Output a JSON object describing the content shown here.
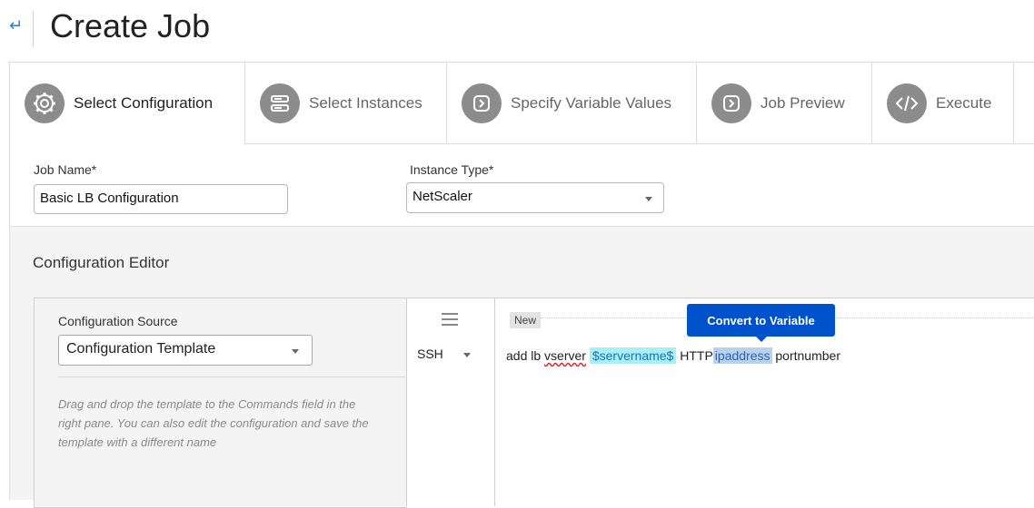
{
  "header": {
    "title": "Create Job"
  },
  "tabs": [
    {
      "label": "Select Configuration",
      "active": true,
      "icon": "gear-icon"
    },
    {
      "label": "Select Instances",
      "active": false,
      "icon": "server-icon"
    },
    {
      "label": "Specify Variable Values",
      "active": false,
      "icon": "chevron-right-icon"
    },
    {
      "label": "Job Preview",
      "active": false,
      "icon": "chevron-right-icon"
    },
    {
      "label": "Execute",
      "active": false,
      "icon": "code-icon"
    }
  ],
  "form": {
    "job_name_label": "Job Name*",
    "job_name_value": "Basic LB Configuration",
    "instance_type_label": "Instance Type*",
    "instance_type_value": "NetScaler"
  },
  "editor": {
    "title": "Configuration Editor",
    "source_label": "Configuration Source",
    "source_value": "Configuration Template",
    "help_text": "Drag and drop the template to the Commands field in the right pane. You can also edit the configuration and save the template with a different name",
    "protocol": "SSH",
    "new_badge": "New",
    "tooltip": "Convert to Variable",
    "command": {
      "part1": "add lb ",
      "part2": "vserver",
      "variable": "$servername$",
      "part3": "HTTP",
      "selected": "ipaddress",
      "part4": "portnumber"
    }
  },
  "colors": {
    "accent": "#0052cc",
    "variable_bg": "#a9f0f5",
    "selection_bg": "#b9d1ec"
  }
}
